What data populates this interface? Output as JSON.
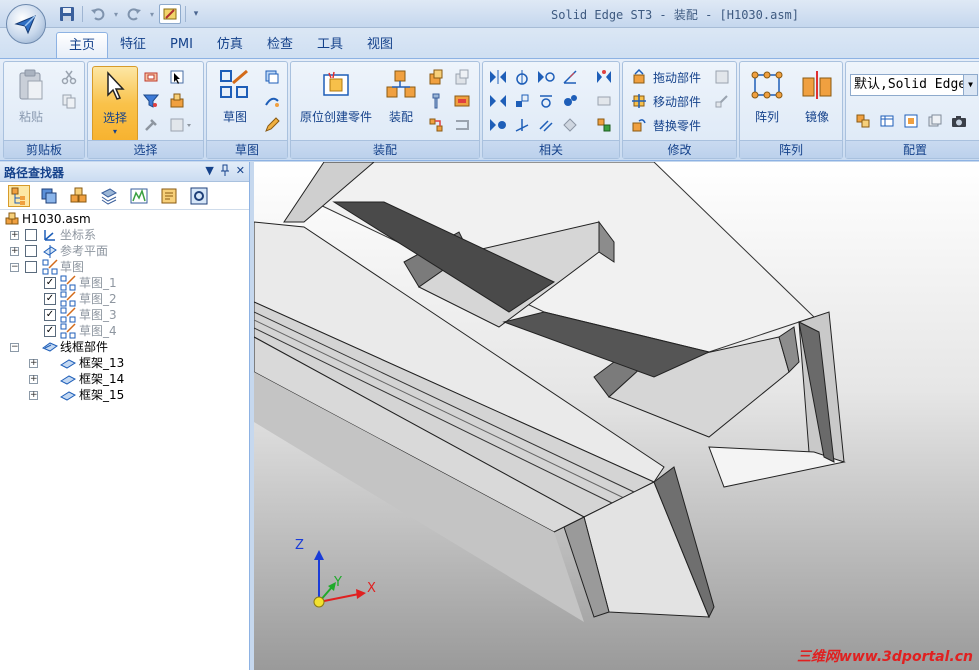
{
  "window": {
    "title": "Solid Edge ST3 - 装配 - [H1030.asm]"
  },
  "tabs": [
    {
      "label": "主页",
      "active": true
    },
    {
      "label": "特征"
    },
    {
      "label": "PMI"
    },
    {
      "label": "仿真"
    },
    {
      "label": "检查"
    },
    {
      "label": "工具"
    },
    {
      "label": "视图"
    }
  ],
  "ribbon": {
    "clipboard": {
      "label": "剪贴板",
      "paste": "粘贴"
    },
    "select": {
      "label": "选择",
      "select_button": "选择"
    },
    "sketch": {
      "label": "草图",
      "sketch_button": "草图"
    },
    "assemble": {
      "label": "装配",
      "create_in_place": "原位创建零件",
      "assemble_button": "装配"
    },
    "relate": {
      "label": "相关"
    },
    "modify": {
      "label": "修改",
      "drag_component": "拖动部件",
      "move_component": "移动部件",
      "replace_part": "替换零件"
    },
    "pattern": {
      "label": "阵列",
      "pattern_button": "阵列",
      "mirror_button": "镜像"
    },
    "configuration": {
      "label": "配置",
      "selected": "默认,Solid Edge"
    }
  },
  "pathfinder": {
    "title": "路径查找器",
    "controls": {
      "menu": "▼",
      "pin": "📌",
      "close": "✕"
    },
    "tree": {
      "root": "H1030.asm",
      "coordinate_systems": "坐标系",
      "reference_planes": "参考平面",
      "sketches": "草图",
      "sketch_items": [
        "草图_1",
        "草图_2",
        "草图_3",
        "草图_4"
      ],
      "wireframe": "线框部件",
      "frames": [
        "框架_13",
        "框架_14",
        "框架_15"
      ]
    }
  },
  "viewport": {
    "axes": {
      "x": "X",
      "y": "Y",
      "z": "Z"
    },
    "watermark": "三维网www.3dportal.cn"
  },
  "colors": {
    "accent": "#15428b",
    "ribbon_bg": "#d7e4f4",
    "selected": "#f9c24a",
    "axis_x": "#e02020",
    "axis_y": "#1faa2a",
    "axis_z": "#1a3cd8",
    "watermark": "#e02020"
  }
}
